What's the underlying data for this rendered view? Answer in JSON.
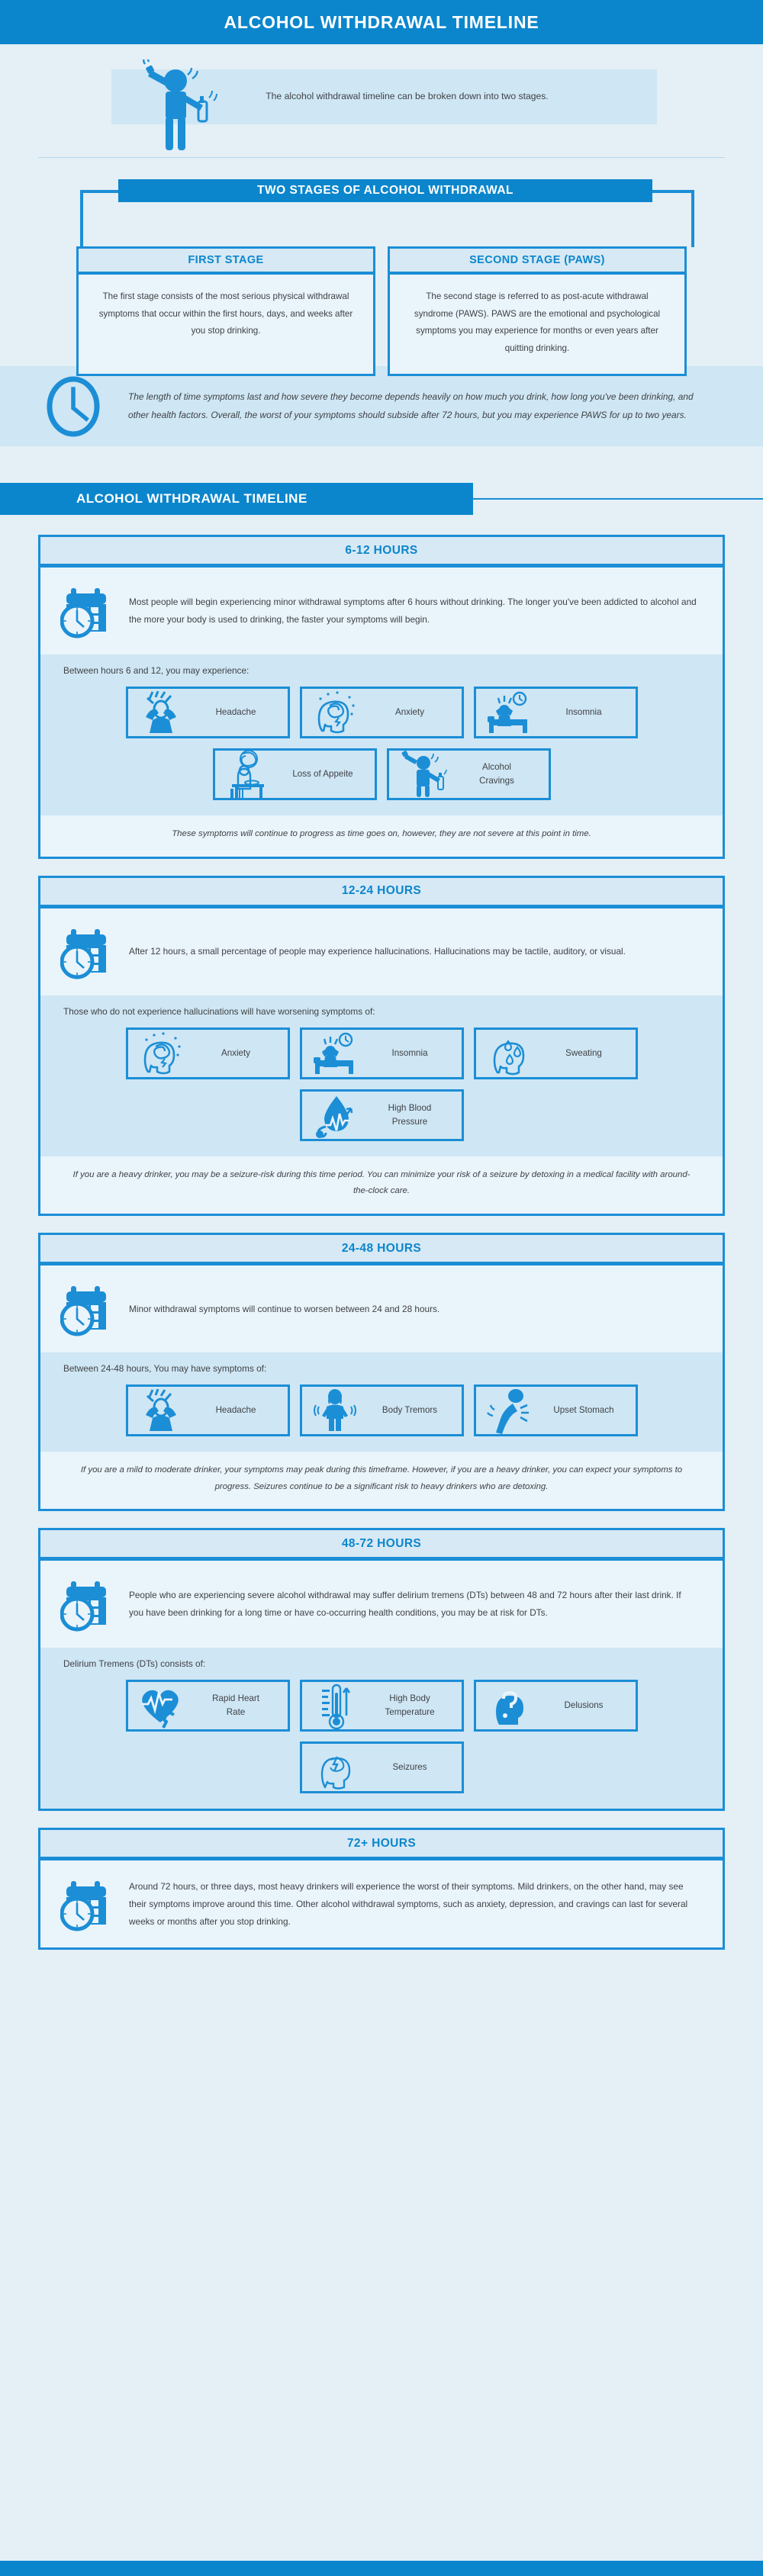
{
  "colors": {
    "brand": "#0b86cc",
    "border": "#1b8ed6",
    "bg": "#e4eff6",
    "band": "#cfe6f4",
    "card_bg": "#eaf4fb",
    "head_bg": "#d7e9f5",
    "text": "#3f4245"
  },
  "header": {
    "title": "ALCOHOL WITHDRAWAL TIMELINE"
  },
  "intro": {
    "text": "The alcohol withdrawal timeline can be broken down into two stages."
  },
  "stages": {
    "title": "TWO STAGES OF ALCOHOL WITHDRAWAL",
    "cards": [
      {
        "heading": "FIRST STAGE",
        "body": "The first stage consists of the most serious physical withdrawal symptoms that occur within the first hours, days, and weeks after you stop drinking."
      },
      {
        "heading": "SECOND STAGE (PAWS)",
        "body": "The second stage is referred to as post-acute withdrawal syndrome (PAWS). PAWS are the emotional and psychological symptoms you may experience for months or even years after quitting drinking."
      }
    ]
  },
  "clock_note": {
    "text": "The length of time symptoms last and how severe they become depends heavily on how much you drink, how long you've been drinking, and other health factors. Overall, the worst of your symptoms should subside after 72 hours, but you may experience PAWS for up to two years."
  },
  "timeline_banner": {
    "title": "ALCOHOL WITHDRAWAL TIMELINE"
  },
  "timeline": [
    {
      "heading": "6-12 HOURS",
      "intro": "Most people will begin experiencing minor withdrawal symptoms after 6 hours without drinking. The longer you've been addicted to alcohol and the more your body is used to drinking, the faster your symptoms will begin.",
      "symptoms_lead": "Between hours 6 and 12, you may experience:",
      "symptoms": [
        {
          "label": "Headache",
          "icon": "headache-icon"
        },
        {
          "label": "Anxiety",
          "icon": "anxiety-head-icon"
        },
        {
          "label": "Insomnia",
          "icon": "insomnia-icon"
        },
        {
          "label": "Loss of Appeite",
          "icon": "loss-of-appetite-icon"
        },
        {
          "label": "Alcohol\nCravings",
          "icon": "alcohol-cravings-icon"
        }
      ],
      "note": "These symptoms will continue to progress as time goes on, however, they are not severe at this point in time."
    },
    {
      "heading": "12-24 HOURS",
      "intro": "After 12 hours, a small percentage of people may experience hallucinations. Hallucinations may be tactile, auditory, or visual.",
      "symptoms_lead": "Those who do not experience hallucinations will have worsening symptoms of:",
      "symptoms": [
        {
          "label": "Anxiety",
          "icon": "anxiety-head-icon"
        },
        {
          "label": "Insomnia",
          "icon": "insomnia-icon"
        },
        {
          "label": "Sweating",
          "icon": "sweating-icon"
        },
        {
          "label": "High Blood\nPressure",
          "icon": "blood-pressure-icon"
        }
      ],
      "note": "If you are a heavy drinker, you may be a seizure-risk during this time period. You can minimize your risk of a seizure by detoxing in a medical facility with around-the-clock care."
    },
    {
      "heading": "24-48 HOURS",
      "intro": "Minor withdrawal symptoms will continue to worsen between 24 and 28 hours.",
      "symptoms_lead": "Between 24-48 hours, You may have symptoms of:",
      "symptoms": [
        {
          "label": "Headache",
          "icon": "headache-icon"
        },
        {
          "label": "Body Tremors",
          "icon": "body-tremors-icon"
        },
        {
          "label": "Upset Stomach",
          "icon": "upset-stomach-icon"
        }
      ],
      "note": "If you are a mild to moderate drinker, your symptoms may peak during this timeframe. However, if you are a heavy drinker, you can expect your symptoms to progress. Seizures continue to be a significant risk to heavy drinkers who are detoxing."
    },
    {
      "heading": "48-72 HOURS",
      "intro": "People who are experiencing severe alcohol withdrawal may suffer delirium tremens (DTs) between 48 and 72 hours after their last drink. If you have been drinking for a long time or have co-occurring health conditions, you may be at risk for DTs.",
      "symptoms_lead": "Delirium Tremens (DTs) consists of:",
      "symptoms": [
        {
          "label": "Rapid Heart\nRate",
          "icon": "rapid-heart-rate-icon"
        },
        {
          "label": "High Body\nTemperature",
          "icon": "thermometer-icon"
        },
        {
          "label": "Delusions",
          "icon": "delusions-icon"
        },
        {
          "label": "Seizures",
          "icon": "seizures-icon"
        }
      ],
      "note": ""
    },
    {
      "heading": "72+ HOURS",
      "intro": "Around 72 hours, or three days, most heavy drinkers will experience the worst of their symptoms. Mild drinkers, on the other hand, may see their symptoms improve around this time. Other alcohol withdrawal symptoms, such as anxiety, depression, and cravings can last for several weeks or months after you stop drinking.",
      "symptoms_lead": "",
      "symptoms": [],
      "note": ""
    }
  ]
}
